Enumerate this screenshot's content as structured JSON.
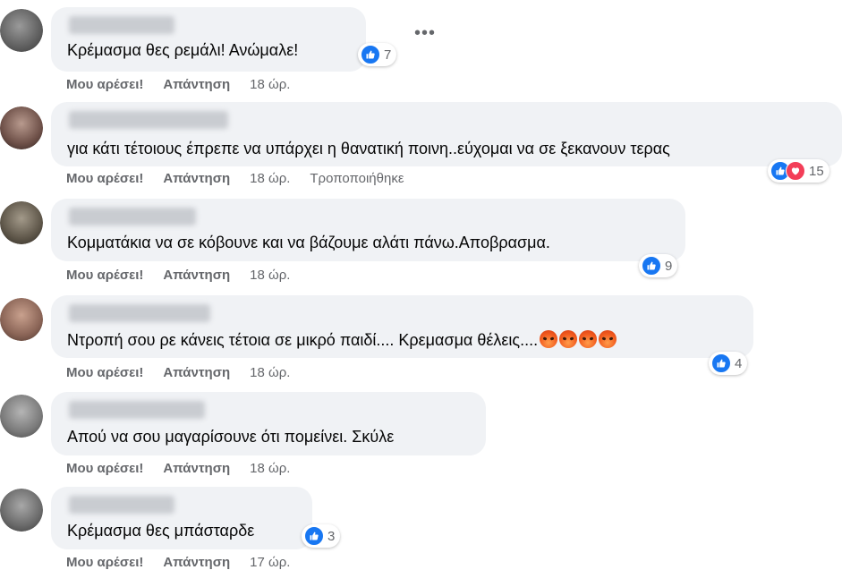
{
  "labels": {
    "like": "Μου αρέσει!",
    "reply": "Απάντηση",
    "more": "•••"
  },
  "comments": [
    {
      "text": "Κρέμασμα θες ρεμάλι! Ανώμαλε!",
      "time": "18 ώρ.",
      "edited": "",
      "reactions": [
        "like"
      ],
      "count": "7"
    },
    {
      "text": "για κάτι τέτοιους έπρεπε να υπάρχει η θανατική ποινη..εύχομαι να σε ξεκανουν τερας",
      "time": "18 ώρ.",
      "edited": "Τροποποιήθηκε",
      "reactions": [
        "like",
        "love"
      ],
      "count": "15"
    },
    {
      "text": "Κομματάκια να σε κόβουνε και να βάζουμε αλάτι πάνω.Αποβρασμα.",
      "time": "18 ώρ.",
      "edited": "",
      "reactions": [
        "like"
      ],
      "count": "9"
    },
    {
      "text": "Ντροπή σου ρε κάνεις τέτοια σε μικρό παιδί.... Κρεμασμα θέλεις....",
      "time": "18 ώρ.",
      "edited": "",
      "reactions": [
        "like"
      ],
      "count": "4",
      "emoji": [
        "angry-face",
        "angry-face",
        "angry-face",
        "angry-face"
      ]
    },
    {
      "text": "Απού να σου μαγαρίσουνε ότι πομείνει. Σκύλε",
      "time": "18 ώρ.",
      "edited": "",
      "reactions": [],
      "count": ""
    },
    {
      "text": "Κρέμασμα θες μπάσταρδε",
      "time": "17 ώρ.",
      "edited": "",
      "reactions": [
        "like"
      ],
      "count": "3"
    }
  ],
  "colors": {
    "bubble": "#f0f2f5",
    "like": "#1877f2",
    "love": "#f33e58",
    "meta": "#65676b"
  }
}
